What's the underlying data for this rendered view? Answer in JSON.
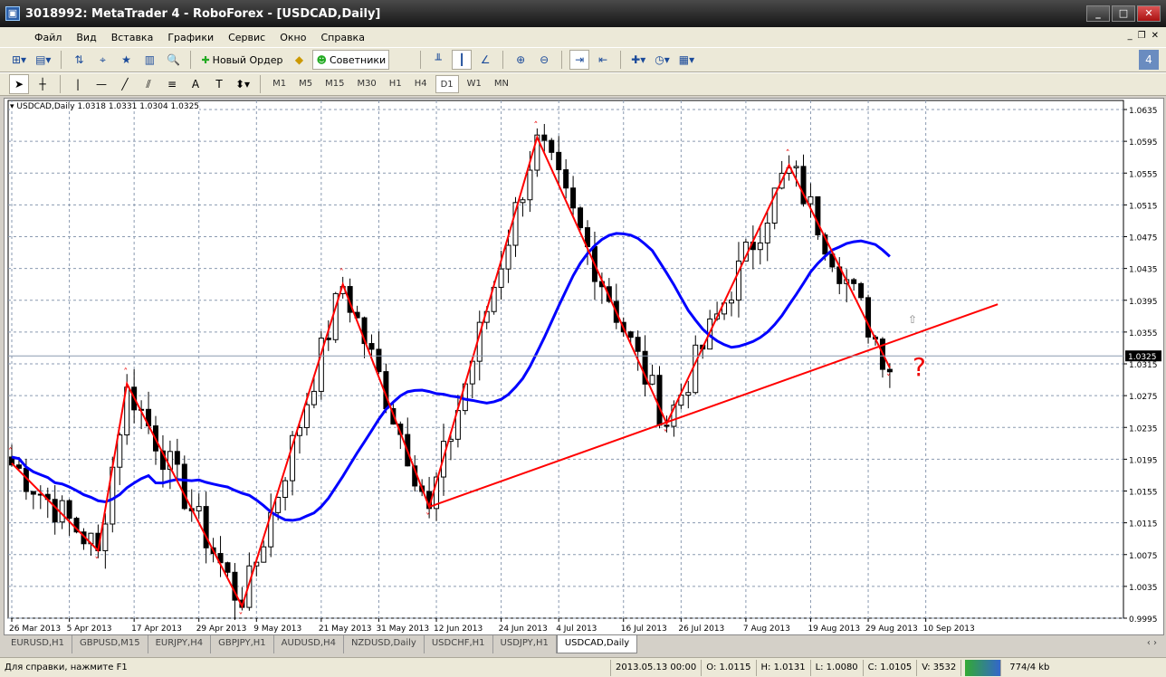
{
  "window": {
    "title": "3018992: MetaTrader 4 - RoboForex - [USDCAD,Daily]"
  },
  "menu": [
    "Файл",
    "Вид",
    "Вставка",
    "Графики",
    "Сервис",
    "Окно",
    "Справка"
  ],
  "toolbar": {
    "new_order": "Новый Ордер",
    "experts": "Советники"
  },
  "timeframes": [
    "M1",
    "M5",
    "M15",
    "M30",
    "H1",
    "H4",
    "D1",
    "W1",
    "MN"
  ],
  "active_timeframe": "D1",
  "chart": {
    "symbol_info": "USDCAD,Daily  1.0318 1.0331 1.0304 1.0325",
    "annotation": "?"
  },
  "tabs": [
    "EURUSD,H1",
    "GBPUSD,M15",
    "EURJPY,H4",
    "GBPJPY,H1",
    "AUDUSD,H4",
    "NZDUSD,Daily",
    "USDCHF,H1",
    "USDJPY,H1",
    "USDCAD,Daily"
  ],
  "active_tab": "USDCAD,Daily",
  "status": {
    "help": "Для справки, нажмите F1",
    "datetime": "2013.05.13 00:00",
    "open": "O: 1.0115",
    "high": "H: 1.0131",
    "low": "L: 1.0080",
    "close": "C: 1.0105",
    "volume": "V: 3532",
    "traffic": "774/4 kb"
  },
  "colors": {
    "ma": "#0000ff",
    "zigzag": "#ff0000",
    "bull": "#ffffff",
    "bear": "#000000"
  },
  "chart_data": {
    "type": "candlestick",
    "symbol": "USDCAD",
    "period": "Daily",
    "current_price": "1.0325",
    "ylim": [
      0.9995,
      1.0635
    ],
    "y_ticks": [
      "1.0635",
      "1.0595",
      "1.0555",
      "1.0515",
      "1.0475",
      "1.0435",
      "1.0395",
      "1.0355",
      "1.0315",
      "1.0275",
      "1.0235",
      "1.0195",
      "1.0155",
      "1.0115",
      "1.0075",
      "1.0035",
      "0.9995"
    ],
    "x_ticks": [
      "26 Mar 2013",
      "5 Apr 2013",
      "17 Apr 2013",
      "29 Apr 2013",
      "9 May 2013",
      "21 May 2013",
      "31 May 2013",
      "12 Jun 2013",
      "24 Jun 2013",
      "4 Jul 2013",
      "16 Jul 2013",
      "26 Jul 2013",
      "7 Aug 2013",
      "19 Aug 2013",
      "29 Aug 2013",
      "10 Sep 2013"
    ],
    "zigzag_pivots": [
      [
        0,
        1.019
      ],
      [
        12,
        1.008
      ],
      [
        16,
        1.029
      ],
      [
        32,
        1.001
      ],
      [
        46,
        1.0415
      ],
      [
        58,
        1.0135
      ],
      [
        73,
        1.06
      ],
      [
        91,
        1.024
      ],
      [
        108,
        1.0565
      ],
      [
        122,
        1.031
      ]
    ],
    "trendline": [
      [
        58,
        1.0135
      ],
      [
        137,
        1.039
      ]
    ],
    "ma_period": 20
  }
}
